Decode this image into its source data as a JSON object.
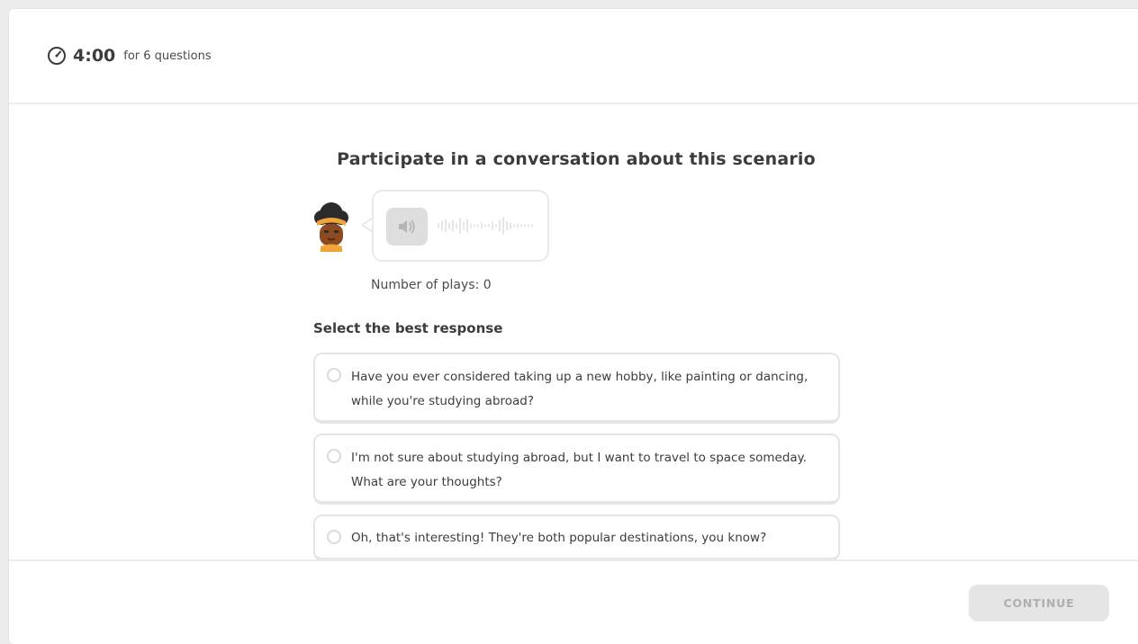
{
  "timer": {
    "icon": "timer-icon",
    "value": "4:00",
    "label": "for 6 questions"
  },
  "task": {
    "title": "Participate in a conversation about this scenario",
    "character_icon": "character-avatar",
    "audio": {
      "icon": "speaker-icon",
      "plays_label": "Number of plays: 0"
    },
    "select_label": "Select the best response",
    "options": [
      {
        "text": "Have you ever considered taking up a new hobby, like painting or dancing, while you're studying abroad?",
        "selected": false
      },
      {
        "text": "I'm not sure about studying abroad, but I want to travel to space someday. What are your thoughts?",
        "selected": false
      },
      {
        "text": "Oh, that's interesting! They're both popular destinations, you know?",
        "selected": false
      }
    ]
  },
  "footer": {
    "continue_label": "CONTINUE",
    "continue_enabled": false
  },
  "colors": {
    "text": "#3c3c3c",
    "border": "#e5e5e5",
    "disabled_button_bg": "#e5e5e5",
    "disabled_button_text": "#afafaf"
  }
}
